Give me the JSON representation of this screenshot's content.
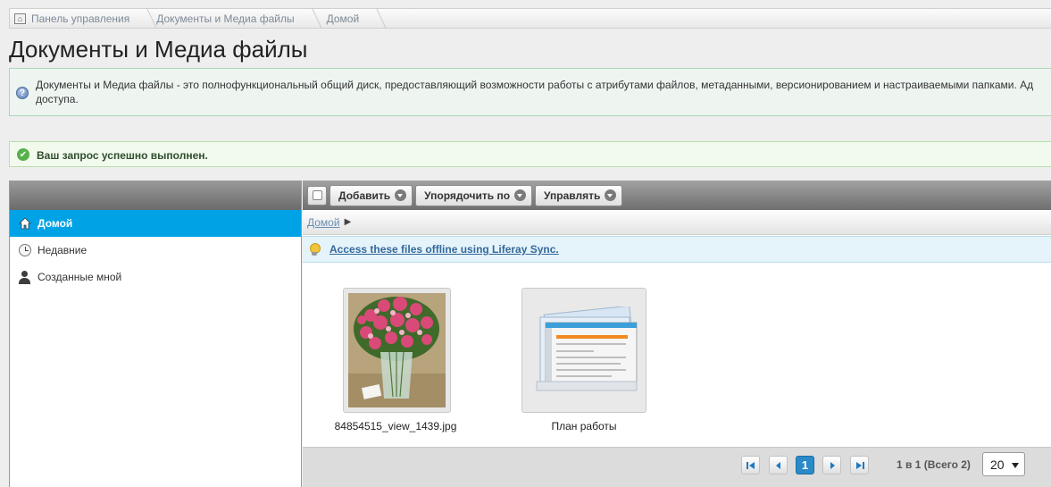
{
  "breadcrumb": {
    "items": [
      "Панель управления",
      "Документы и Медиа файлы",
      "Домой"
    ]
  },
  "page": {
    "title": "Документы и Медиа файлы",
    "info_text": "Документы и Медиа файлы - это полнофункциональный общий диск, предоставляющий возможности работы с атрибутами файлов, метаданными, версионированием и настраиваемыми папками. Ад доступа.",
    "success_text": "Ваш запрос успешно выполнен."
  },
  "sidebar": {
    "items": [
      {
        "label": "Домой",
        "icon": "home-icon",
        "active": true
      },
      {
        "label": "Недавние",
        "icon": "clock-icon",
        "active": false
      },
      {
        "label": "Созданные мной",
        "icon": "user-icon",
        "active": false
      }
    ]
  },
  "toolbar": {
    "add_label": "Добавить",
    "sort_label": "Упорядочить по",
    "manage_label": "Управлять"
  },
  "path": {
    "current": "Домой"
  },
  "sync": {
    "text": "Access these files offline using Liferay Sync."
  },
  "files": [
    {
      "name": "84854515_view_1439.jpg",
      "type": "image"
    },
    {
      "name": "План работы",
      "type": "document"
    }
  ],
  "pagination": {
    "current_page": "1",
    "summary": "1 в 1 (Всего 2)",
    "per_page": "20"
  },
  "colors": {
    "active_nav": "#00a2e6",
    "accent": "#2a8ac8",
    "success_border": "#b8dfa9",
    "info_border": "#a9d7b5"
  }
}
